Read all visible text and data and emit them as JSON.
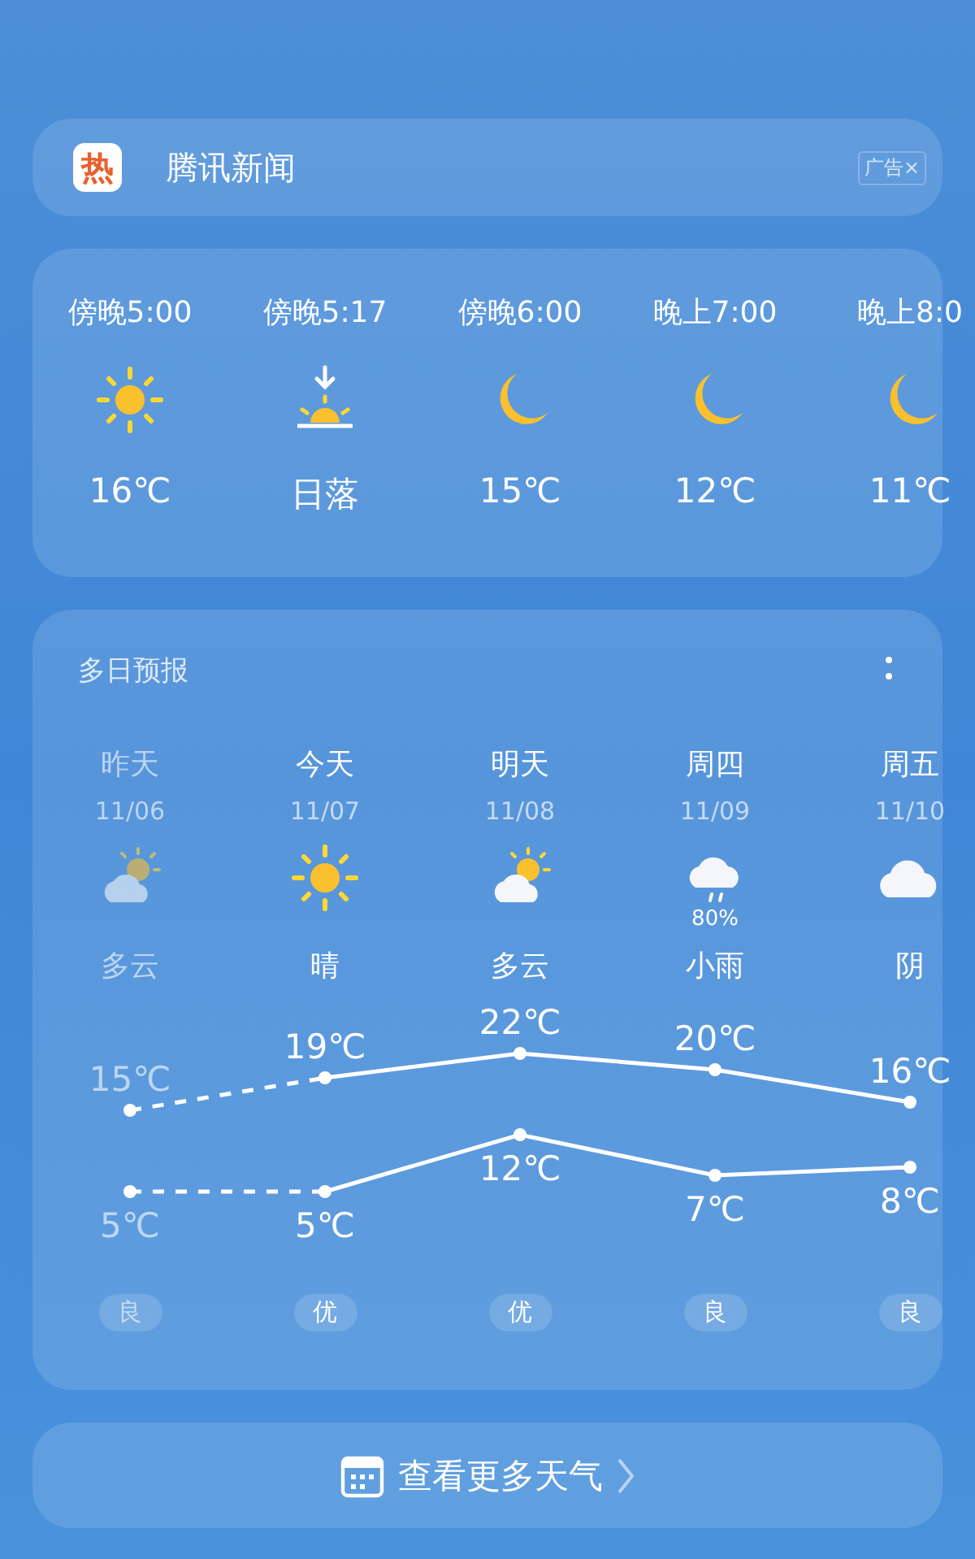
{
  "ad": {
    "logo_text": "热",
    "title": "腾讯新闻",
    "badge": "广告",
    "close": "×"
  },
  "hourly": [
    {
      "time": "傍晚5:00",
      "kind": "sun",
      "value": "16℃"
    },
    {
      "time": "傍晚5:17",
      "kind": "sunset",
      "value": "日落"
    },
    {
      "time": "傍晚6:00",
      "kind": "moon",
      "value": "15℃"
    },
    {
      "time": "晚上7:00",
      "kind": "moon",
      "value": "12℃"
    },
    {
      "time": "晚上8:0",
      "kind": "moon",
      "value": "11℃"
    }
  ],
  "forecast": {
    "title": "多日预报",
    "days": [
      {
        "day": "昨天",
        "date": "11/06",
        "kind": "partly_cloudy",
        "condition": "多云",
        "aqi": "良",
        "past": true
      },
      {
        "day": "今天",
        "date": "11/07",
        "kind": "sun",
        "condition": "晴",
        "aqi": "优",
        "past": false
      },
      {
        "day": "明天",
        "date": "11/08",
        "kind": "partly_cloudy",
        "condition": "多云",
        "aqi": "优",
        "past": false
      },
      {
        "day": "周四",
        "date": "11/09",
        "kind": "rain",
        "precip": "80%",
        "condition": "小雨",
        "aqi": "良",
        "past": false
      },
      {
        "day": "周五",
        "date": "11/10",
        "kind": "cloudy",
        "condition": "阴",
        "aqi": "良",
        "past": false
      }
    ],
    "chart_data": {
      "type": "line",
      "categories": [
        null,
        null,
        null,
        null,
        null
      ],
      "series": [
        {
          "color": "#ffffff",
          "line_style": "partly_dashed",
          "values": [
            15,
            19,
            22,
            20,
            16
          ],
          "value_labels": [
            "15℃",
            "19℃",
            "22℃",
            "20℃",
            "16℃"
          ]
        },
        {
          "color": "#ffffff",
          "line_style": "partly_dashed",
          "values": [
            5,
            5,
            12,
            7,
            8
          ],
          "value_labels": [
            "5℃",
            "5℃",
            "12℃",
            "7℃",
            "8℃"
          ]
        }
      ]
    }
  },
  "more_button": "查看更多天气"
}
